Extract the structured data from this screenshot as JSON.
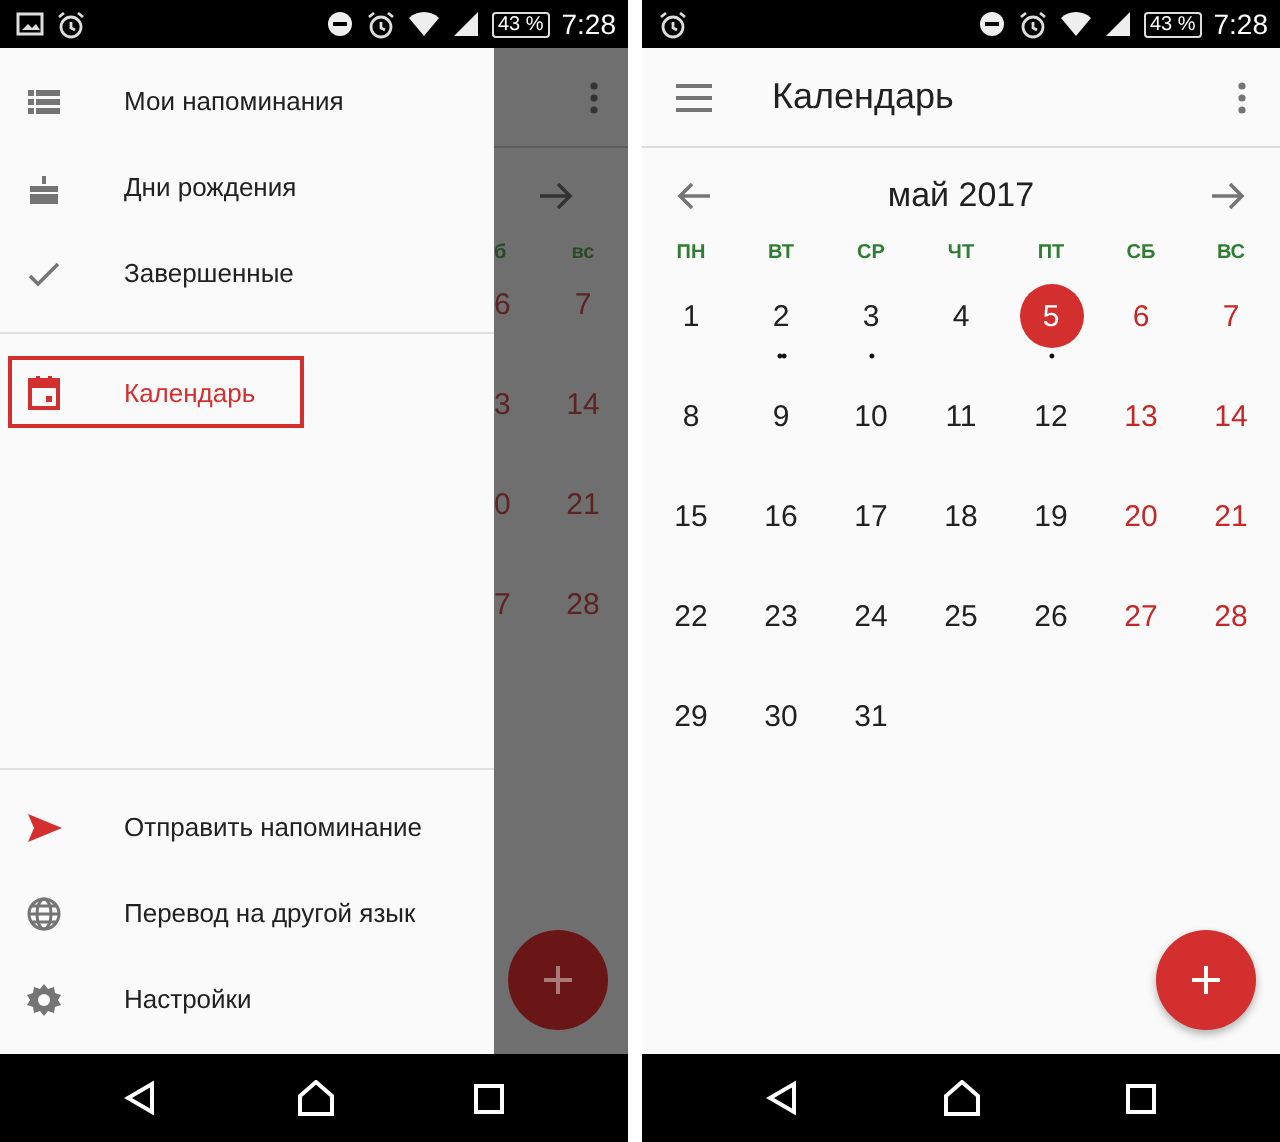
{
  "screens": [
    {
      "kind": "drawer_open",
      "status_bar": {
        "notification_icons": [
          {
            "kind": "image"
          },
          {
            "kind": "alarm"
          }
        ],
        "system_icons": [
          {
            "kind": "dnd"
          },
          {
            "kind": "alarm"
          },
          {
            "kind": "wifi"
          },
          {
            "kind": "signal"
          }
        ],
        "battery": "43 %",
        "time": "7:28"
      },
      "drawer": {
        "items": [
          {
            "kind": "list",
            "label": "Мои напоминания",
            "selected": false
          },
          {
            "kind": "cake",
            "label": "Дни рождения",
            "selected": false
          },
          {
            "kind": "check",
            "label": "Завершенные",
            "selected": false
          },
          {
            "kind": "calendar",
            "label": "Календарь",
            "selected": true
          }
        ],
        "footer_items": [
          {
            "kind": "send",
            "label": "Отправить напоминание"
          },
          {
            "kind": "globe",
            "label": "Перевод на другой язык"
          },
          {
            "kind": "gear",
            "label": "Настройки"
          }
        ]
      },
      "peek": {
        "weekdays": [
          "б",
          "вс"
        ],
        "rows": [
          [
            "6",
            "7"
          ],
          [
            "3",
            "14"
          ],
          [
            "0",
            "21"
          ],
          [
            "7",
            "28"
          ]
        ]
      }
    },
    {
      "kind": "calendar",
      "status_bar": {
        "notification_icons": [
          {
            "kind": "alarm"
          }
        ],
        "system_icons": [
          {
            "kind": "dnd"
          },
          {
            "kind": "alarm"
          },
          {
            "kind": "wifi"
          },
          {
            "kind": "signal"
          }
        ],
        "battery": "43 %",
        "time": "7:28"
      },
      "app_bar": {
        "title": "Календарь"
      },
      "calendar": {
        "month": "май 2017",
        "weekdays": [
          "ПН",
          "ВТ",
          "СР",
          "ЧТ",
          "ПТ",
          "СБ",
          "ВС"
        ],
        "days": [
          {
            "day": "1",
            "weekend": false,
            "selected": false
          },
          {
            "day": "2",
            "weekend": false,
            "selected": false,
            "dots": "••"
          },
          {
            "day": "3",
            "weekend": false,
            "selected": false,
            "dots": "•"
          },
          {
            "day": "4",
            "weekend": false,
            "selected": false
          },
          {
            "day": "5",
            "weekend": false,
            "selected": true,
            "dots": "•"
          },
          {
            "day": "6",
            "weekend": true,
            "selected": false
          },
          {
            "day": "7",
            "weekend": true,
            "selected": false
          },
          {
            "day": "8",
            "weekend": false,
            "selected": false
          },
          {
            "day": "9",
            "weekend": false,
            "selected": false
          },
          {
            "day": "10",
            "weekend": false,
            "selected": false
          },
          {
            "day": "11",
            "weekend": false,
            "selected": false
          },
          {
            "day": "12",
            "weekend": false,
            "selected": false
          },
          {
            "day": "13",
            "weekend": true,
            "selected": false
          },
          {
            "day": "14",
            "weekend": true,
            "selected": false
          },
          {
            "day": "15",
            "weekend": false,
            "selected": false
          },
          {
            "day": "16",
            "weekend": false,
            "selected": false
          },
          {
            "day": "17",
            "weekend": false,
            "selected": false
          },
          {
            "day": "18",
            "weekend": false,
            "selected": false
          },
          {
            "day": "19",
            "weekend": false,
            "selected": false
          },
          {
            "day": "20",
            "weekend": true,
            "selected": false
          },
          {
            "day": "21",
            "weekend": true,
            "selected": false
          },
          {
            "day": "22",
            "weekend": false,
            "selected": false
          },
          {
            "day": "23",
            "weekend": false,
            "selected": false
          },
          {
            "day": "24",
            "weekend": false,
            "selected": false
          },
          {
            "day": "25",
            "weekend": false,
            "selected": false
          },
          {
            "day": "26",
            "weekend": false,
            "selected": false
          },
          {
            "day": "27",
            "weekend": true,
            "selected": false
          },
          {
            "day": "28",
            "weekend": true,
            "selected": false
          },
          {
            "day": "29",
            "weekend": false,
            "selected": false
          },
          {
            "day": "30",
            "weekend": false,
            "selected": false
          },
          {
            "day": "31",
            "weekend": false,
            "selected": false
          }
        ]
      }
    }
  ]
}
